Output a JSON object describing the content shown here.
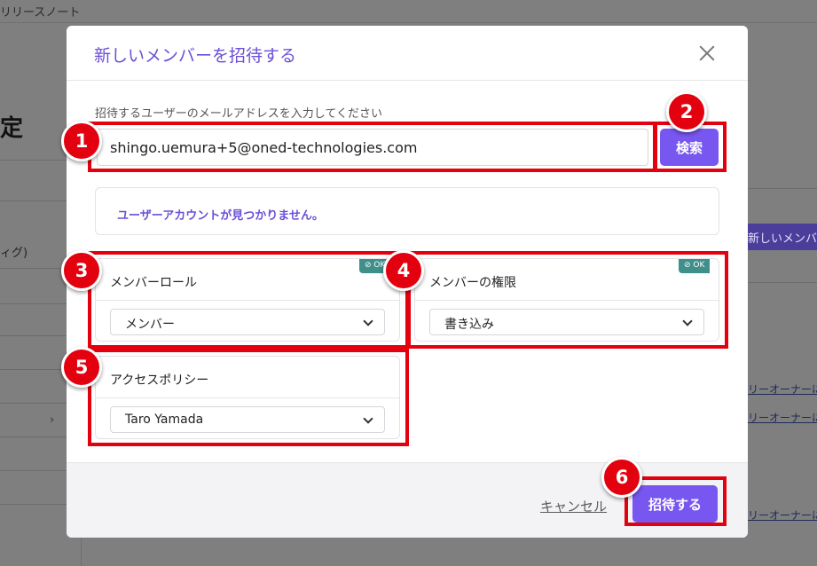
{
  "background": {
    "topbar_text": "リリースノート",
    "big_char": "定",
    "sidebar_text": "ィグ)",
    "sidebar_chevron": "›",
    "right_button_text": "新しいメンバ",
    "right_links": [
      "リーオーナーに",
      "リーオーナーに",
      "リーオーナーに"
    ]
  },
  "modal": {
    "title": "新しいメンバーを招待する",
    "email_label": "招待するユーザーのメールアドレスを入力してください",
    "email_value": "shingo.uemura+5@oned-technologies.com",
    "search_button": "検索",
    "notice": "ユーザーアカウントが見つかりません。",
    "role_card": {
      "title": "メンバーロール",
      "value": "メンバー",
      "badge": "⊘ OK"
    },
    "permission_card": {
      "title": "メンバーの権限",
      "value": "書き込み",
      "badge": "⊘ OK"
    },
    "policy_card": {
      "title": "アクセスポリシー",
      "value": "Taro Yamada"
    },
    "cancel_label": "キャンセル",
    "invite_button": "招待する"
  },
  "markers": [
    "1",
    "2",
    "3",
    "4",
    "5",
    "6"
  ],
  "colors": {
    "accent": "#7856f0",
    "title": "#6b4fd8",
    "highlight": "#e3000f",
    "badge": "#3f8f8a"
  }
}
